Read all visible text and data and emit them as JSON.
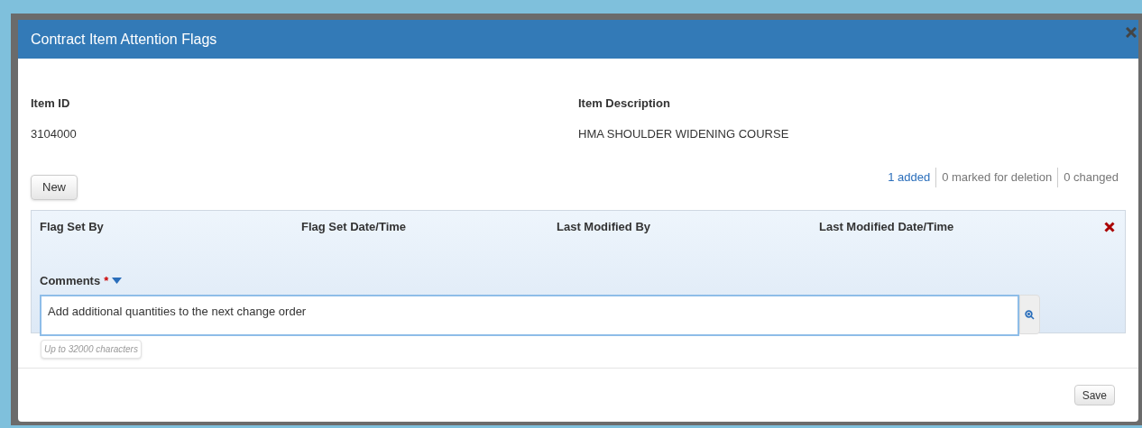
{
  "dialog": {
    "title": "Contract Item Attention Flags"
  },
  "fields": [
    {
      "label": "Item ID",
      "value": "3104000"
    },
    {
      "label": "Item Description",
      "value": "HMA SHOULDER WIDENING COURSE"
    }
  ],
  "new_button": "New",
  "counts": [
    {
      "text": "1 added",
      "highlighted": true
    },
    {
      "text": "0 marked for deletion",
      "highlighted": false
    },
    {
      "text": "0 changed",
      "highlighted": false
    }
  ],
  "flag_row": {
    "columns": [
      "Flag Set By",
      "Flag Set Date/Time",
      "Last Modified By",
      "Last Modified Date/Time"
    ],
    "comments": {
      "label": "Comments",
      "required_mark": "*",
      "value": "Add additional quantities to the next change order",
      "hint": "Up to 32000 characters"
    }
  },
  "save_button": "Save"
}
